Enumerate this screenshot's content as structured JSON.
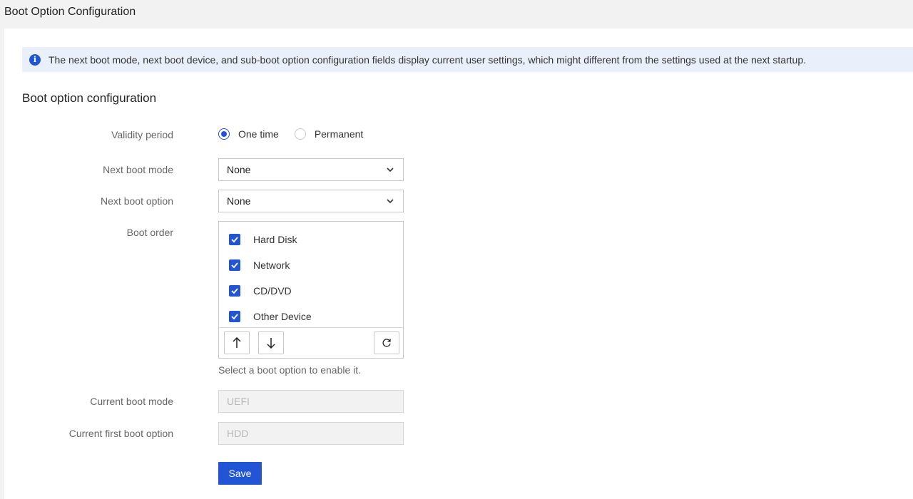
{
  "page": {
    "title": "Boot Option Configuration"
  },
  "info": {
    "text": "The next boot mode, next boot device, and sub-boot option configuration fields display current user settings, which might different from the settings used at the next startup."
  },
  "section": {
    "title": "Boot option configuration"
  },
  "validity": {
    "label": "Validity period",
    "options": [
      {
        "label": "One time",
        "selected": true
      },
      {
        "label": "Permanent",
        "selected": false
      }
    ]
  },
  "next_boot_mode": {
    "label": "Next boot mode",
    "value": "None"
  },
  "next_boot_option": {
    "label": "Next boot option",
    "value": "None"
  },
  "boot_order": {
    "label": "Boot order",
    "items": [
      {
        "label": "Hard Disk",
        "checked": true
      },
      {
        "label": "Network",
        "checked": true
      },
      {
        "label": "CD/DVD",
        "checked": true
      },
      {
        "label": "Other Device",
        "checked": true
      }
    ],
    "hint": "Select a boot option to enable it."
  },
  "current_boot_mode": {
    "label": "Current boot mode",
    "value": "UEFI"
  },
  "current_first_boot_option": {
    "label": "Current first boot option",
    "value": "HDD"
  },
  "actions": {
    "save_label": "Save"
  },
  "colors": {
    "accent": "#2254d6",
    "info_bg": "#e9f0fb",
    "page_bg": "#f2f2f2"
  }
}
